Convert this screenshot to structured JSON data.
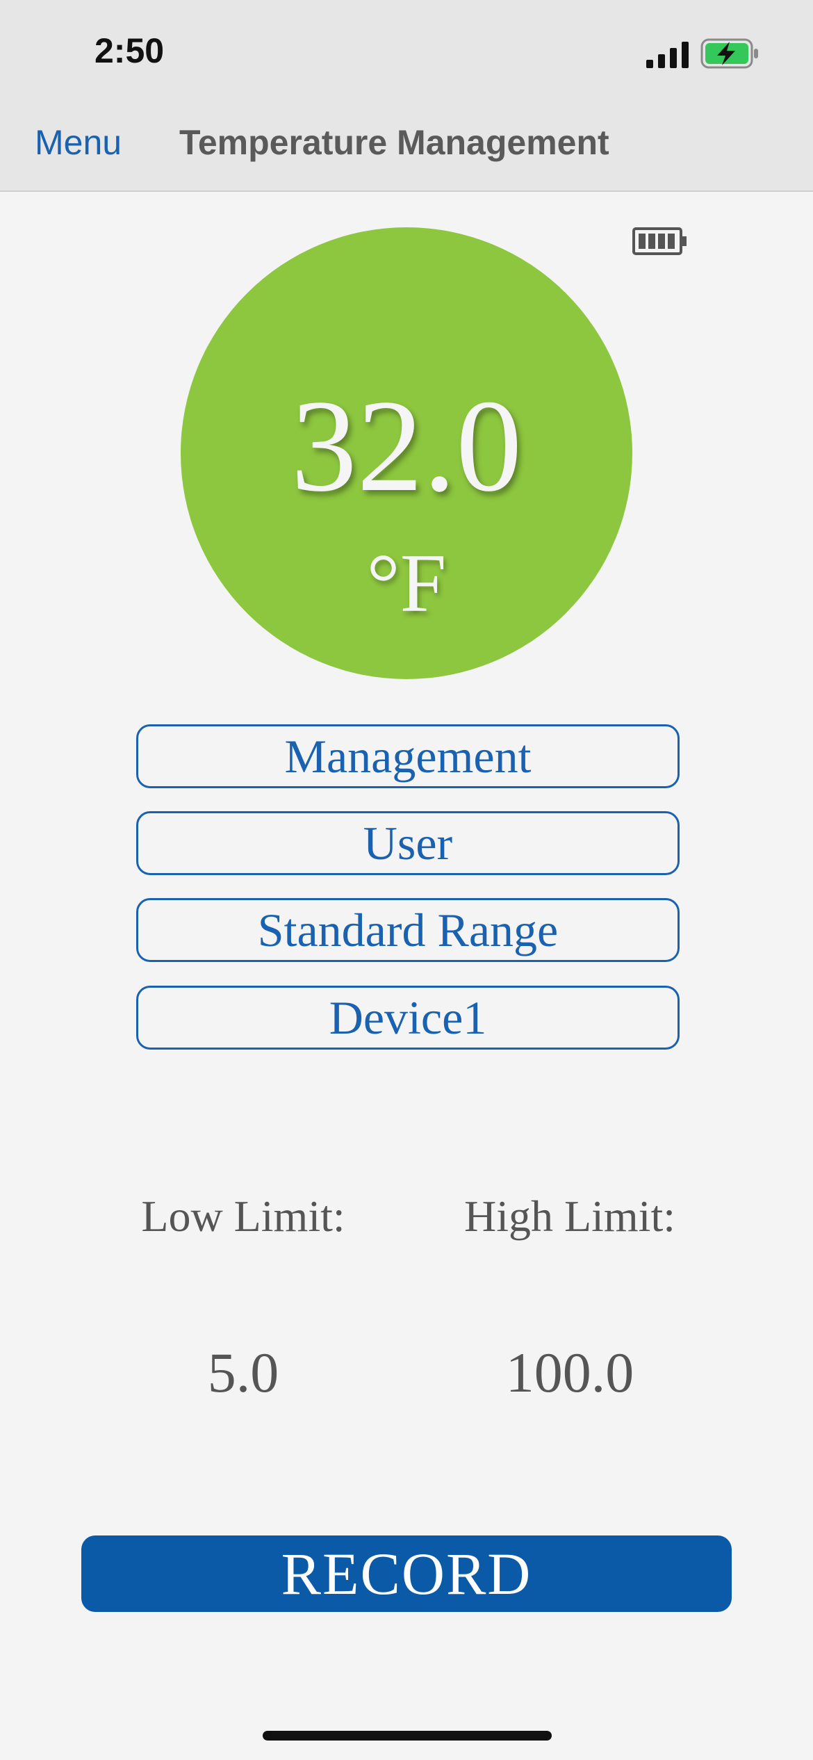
{
  "status_bar": {
    "time": "2:50",
    "signal_icon": "cellular-signal-icon",
    "battery_icon": "battery-charging-icon",
    "battery_color": "#34c759"
  },
  "nav": {
    "menu_label": "Menu",
    "title": "Temperature Management"
  },
  "device_battery_icon": "device-battery-icon",
  "reading": {
    "value": "32.0",
    "unit": "°F",
    "circle_color": "#8dc63f"
  },
  "selectors": {
    "management": "Management",
    "user": "User",
    "range": "Standard Range",
    "device": "Device1"
  },
  "limits": {
    "low_label": "Low Limit:",
    "low_value": "5.0",
    "high_label": "High Limit:",
    "high_value": "100.0"
  },
  "record_label": "RECORD",
  "colors": {
    "accent": "#1a62b0",
    "record_bg": "#0b5aa8"
  }
}
